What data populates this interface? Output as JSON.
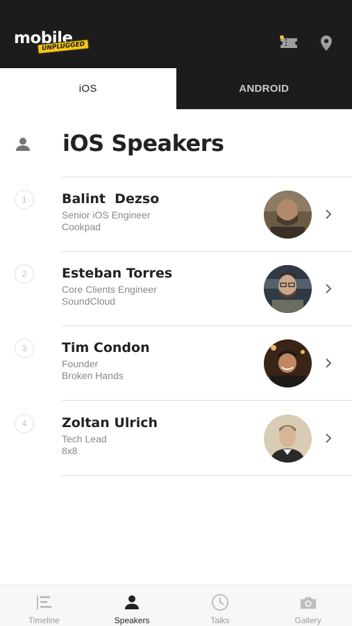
{
  "app": {
    "logo_text": "mobile",
    "logo_tagline": "UNPLUGGED"
  },
  "header": {
    "icons": [
      "ticket-icon",
      "location-pin-icon"
    ]
  },
  "tabs": [
    {
      "label": "iOS",
      "active": true
    },
    {
      "label": "ANDROID",
      "active": false
    }
  ],
  "section": {
    "icon": "person-icon",
    "title": "iOS Speakers"
  },
  "speakers": [
    {
      "number": "1",
      "name": "Balint  Dezso",
      "role": "Senior iOS Engineer",
      "company": "Cookpad"
    },
    {
      "number": "2",
      "name": "Esteban Torres",
      "role": "Core Clients Engineer",
      "company": "SoundCloud"
    },
    {
      "number": "3",
      "name": "Tim Condon",
      "role": "Founder",
      "company": "Broken Hands"
    },
    {
      "number": "4",
      "name": "Zoltan Ulrich",
      "role": "Tech Lead",
      "company": "8x8"
    }
  ],
  "bottom_nav": [
    {
      "label": "Timeline",
      "icon": "timeline-icon",
      "active": false
    },
    {
      "label": "Speakers",
      "icon": "person-icon",
      "active": true
    },
    {
      "label": "Talks",
      "icon": "clock-icon",
      "active": false
    },
    {
      "label": "Gallery",
      "icon": "camera-icon",
      "active": false
    }
  ],
  "colors": {
    "header_bg": "#1c1c1c",
    "accent": "#f5c518",
    "text_primary": "#222222",
    "text_secondary": "#888888"
  }
}
